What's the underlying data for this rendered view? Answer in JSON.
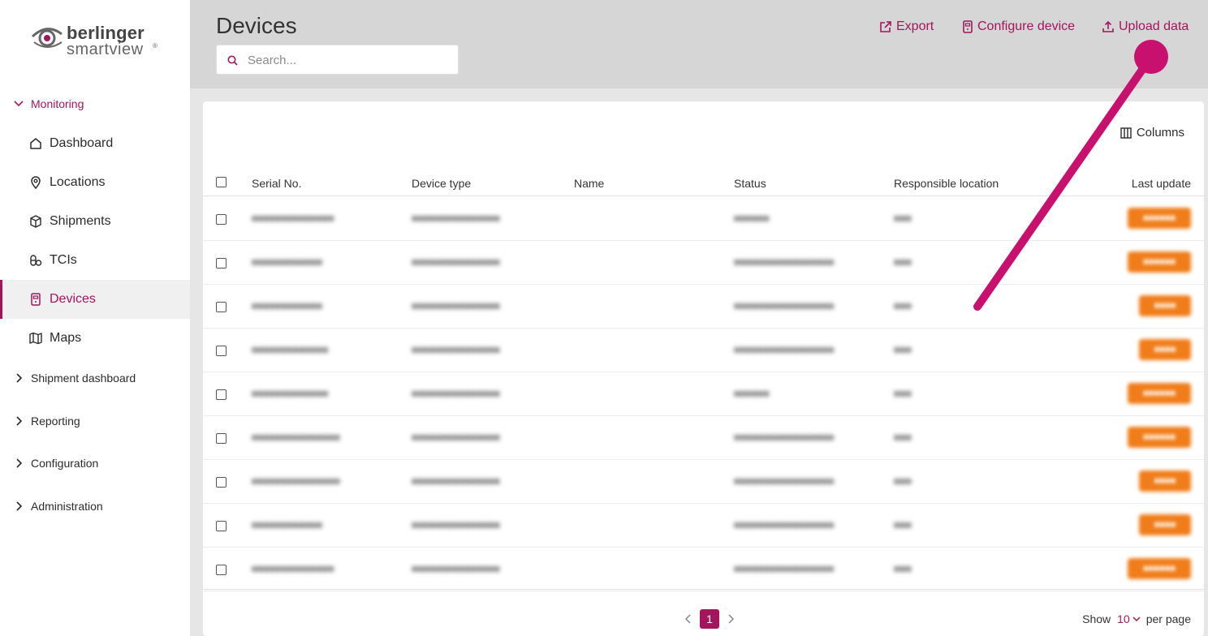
{
  "brand": {
    "name": "berlinger",
    "product": "smartview",
    "reg": "®"
  },
  "sidebar": {
    "monitoring": "Monitoring",
    "items": [
      {
        "label": "Dashboard",
        "icon": "home-icon"
      },
      {
        "label": "Locations",
        "icon": "location-pin-icon"
      },
      {
        "label": "Shipments",
        "icon": "package-icon"
      },
      {
        "label": "TCIs",
        "icon": "pills-icon"
      },
      {
        "label": "Devices",
        "icon": "device-icon",
        "active": true
      },
      {
        "label": "Maps",
        "icon": "map-icon"
      }
    ],
    "groups": [
      "Shipment dashboard",
      "Reporting",
      "Configuration",
      "Administration"
    ]
  },
  "header": {
    "title": "Devices",
    "search_placeholder": "Search...",
    "export_label": "Export",
    "configure_label": "Configure device",
    "upload_label": "Upload data"
  },
  "table": {
    "columns_label": "Columns",
    "headers": [
      "Serial No.",
      "Device type",
      "Name",
      "Status",
      "Responsible location",
      "Last update"
    ],
    "rows": [
      {
        "serial": "■■■■■■■■■■■■■■",
        "type": "■■■■■■■■■■■■■■■",
        "status": "■■■■■■",
        "location": "■■■",
        "badge": "■■■■■■"
      },
      {
        "serial": "■■■■■■■■■■■■",
        "type": "■■■■■■■■■■■■■■■",
        "status": "■■■■■■■■■■■■■■■■■",
        "location": "■■■",
        "badge": "■■■■■■"
      },
      {
        "serial": "■■■■■■■■■■■■",
        "type": "■■■■■■■■■■■■■■■",
        "status": "■■■■■■■■■■■■■■■■■",
        "location": "■■■",
        "badge": "■■■■"
      },
      {
        "serial": "■■■■■■■■■■■■■",
        "type": "■■■■■■■■■■■■■■■",
        "status": "■■■■■■■■■■■■■■■■■",
        "location": "■■■",
        "badge": "■■■■"
      },
      {
        "serial": "■■■■■■■■■■■■■",
        "type": "■■■■■■■■■■■■■■■",
        "status": "■■■■■■",
        "location": "■■■",
        "badge": "■■■■■■"
      },
      {
        "serial": "■■■■■■■■■■■■■■■",
        "type": "■■■■■■■■■■■■■■■",
        "status": "■■■■■■■■■■■■■■■■■",
        "location": "■■■",
        "badge": "■■■■■■"
      },
      {
        "serial": "■■■■■■■■■■■■■■■",
        "type": "■■■■■■■■■■■■■■■",
        "status": "■■■■■■■■■■■■■■■■■",
        "location": "■■■",
        "badge": "■■■■"
      },
      {
        "serial": "■■■■■■■■■■■■",
        "type": "■■■■■■■■■■■■■■■",
        "status": "■■■■■■■■■■■■■■■■■",
        "location": "■■■",
        "badge": "■■■■"
      },
      {
        "serial": "■■■■■■■■■■■■■■",
        "type": "■■■■■■■■■■■■■■■",
        "status": "■■■■■■■■■■■■■■■■■",
        "location": "■■■",
        "badge": "■■■■■■"
      }
    ]
  },
  "pagination": {
    "current_page": "1",
    "show_label": "Show",
    "per_page_value": "10",
    "per_page_label": "per page"
  },
  "colors": {
    "accent": "#a3155d",
    "badge": "#f07d1a",
    "annotation": "#c8106e"
  }
}
